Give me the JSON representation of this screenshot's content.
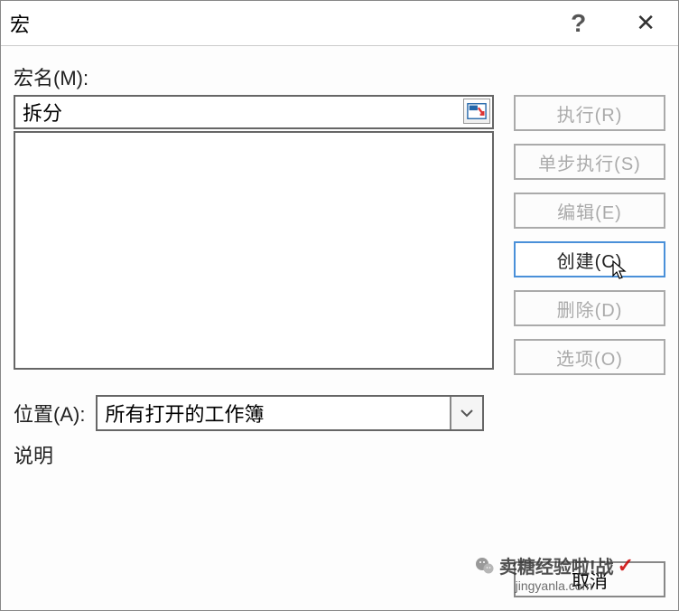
{
  "title": "宏",
  "help_symbol": "?",
  "close_symbol": "✕",
  "labels": {
    "macro_name": "宏名(M):",
    "location": "位置(A):",
    "description": "说明"
  },
  "macro_name_value": "拆分",
  "location_value": "所有打开的工作簿",
  "buttons": {
    "run": "执行(R)",
    "step": "单步执行(S)",
    "edit": "编辑(E)",
    "create": "创建(C)",
    "delete": "删除(D)",
    "options": "选项(O)",
    "cancel": "取消"
  },
  "watermark": {
    "line1": "卖糖经验啦!战",
    "line2": "jingyanla.com"
  }
}
